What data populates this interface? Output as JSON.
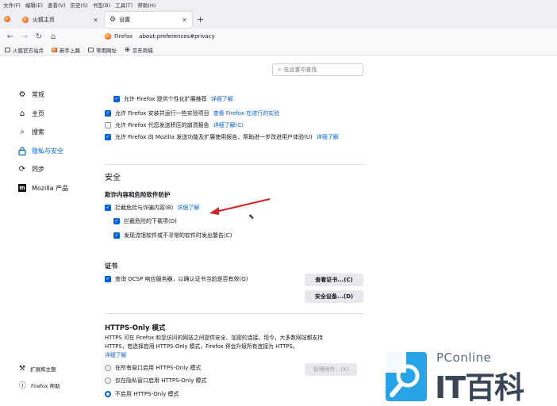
{
  "menubar": [
    "文件(F)",
    "编辑(E)",
    "查看(V)",
    "历史(S)",
    "书签(B)",
    "工具(T)",
    "帮助(H)"
  ],
  "tabs": [
    {
      "label": "火狐主页",
      "active": false
    },
    {
      "label": "设置",
      "active": true
    }
  ],
  "url": {
    "identity": "Firefox",
    "text": "about:preferences#privacy"
  },
  "bookmarks": [
    "火狐官方站点",
    "新手上路",
    "常用网址",
    "京东商城"
  ],
  "search": {
    "placeholder": "在设置中查找"
  },
  "sidebar": {
    "items": [
      {
        "label": "常规",
        "icon": "gear-icon"
      },
      {
        "label": "主页",
        "icon": "home-icon"
      },
      {
        "label": "搜索",
        "icon": "search-icon"
      },
      {
        "label": "隐私与安全",
        "icon": "lock-icon",
        "active": true
      },
      {
        "label": "同步",
        "icon": "sync-icon"
      },
      {
        "label": "Mozilla 产品",
        "icon": "mozilla-icon"
      }
    ],
    "extensions": "扩展和主题",
    "help": "Firefox 帮助"
  },
  "data_collection": {
    "personalized": {
      "label": "允许 Firefox 提供个性化扩展推荐",
      "link": "详细了解",
      "checked": true
    },
    "studies": {
      "label": "允许 Firefox 安装并运行一些实验项目",
      "link": "查看 Firefox 在进行的实验",
      "checked": true
    },
    "crash": {
      "label": "允许 Firefox 代您发送积压的崩溃报告",
      "link": "详细了解(C)",
      "checked": false
    },
    "mozilla": {
      "label": "允许 Firefox 向 Mozilla 发送功能及扩展使用报告，帮助进一步改进用户体验(U)",
      "link": "详细了解",
      "checked": true
    }
  },
  "security": {
    "heading": "安全",
    "subheading": "欺诈内容和危险软件防护",
    "block_dangerous": {
      "label": "拦截危险与诈骗内容(B)",
      "link": "详细了解",
      "checked": true
    },
    "block_downloads": {
      "label": "拦截危险的下载项(D)",
      "checked": true
    },
    "warn_unwanted": {
      "label": "发现流氓软件或不寻常的软件时发出警告(C)",
      "checked": true
    }
  },
  "certificates": {
    "heading": "证书",
    "ocsp": {
      "label": "查询 OCSP 响应服务器，以确认证书当前是否有效(Q)",
      "checked": true
    },
    "view_button": "查看证书...(C)",
    "devices_button": "安全设备...(D)"
  },
  "https_only": {
    "heading": "HTTPS-Only 模式",
    "description_line1": "HTTPS 可在 Firefox 和您访问的网站之间提供安全、加密的连接。现今，大多数网站都支持",
    "description_line2": "HTTPS，若选择启用 HTTPS-Only 模式，Firefox 将会升级所有连接为 HTTPS。",
    "link": "详细了解",
    "options": [
      {
        "label": "在所有窗口启用 HTTPS-Only 模式",
        "selected": false
      },
      {
        "label": "仅在隐私窗口启用 HTTPS-Only 模式",
        "selected": false
      },
      {
        "label": "不启用 HTTPS-Only 模式",
        "selected": true
      }
    ],
    "exceptions_button": "管理例外...(X)"
  },
  "watermark": {
    "brand": "PConline",
    "title": "IT百科"
  },
  "colors": {
    "accent": "#0061e0",
    "arrow": "#d9221c"
  }
}
